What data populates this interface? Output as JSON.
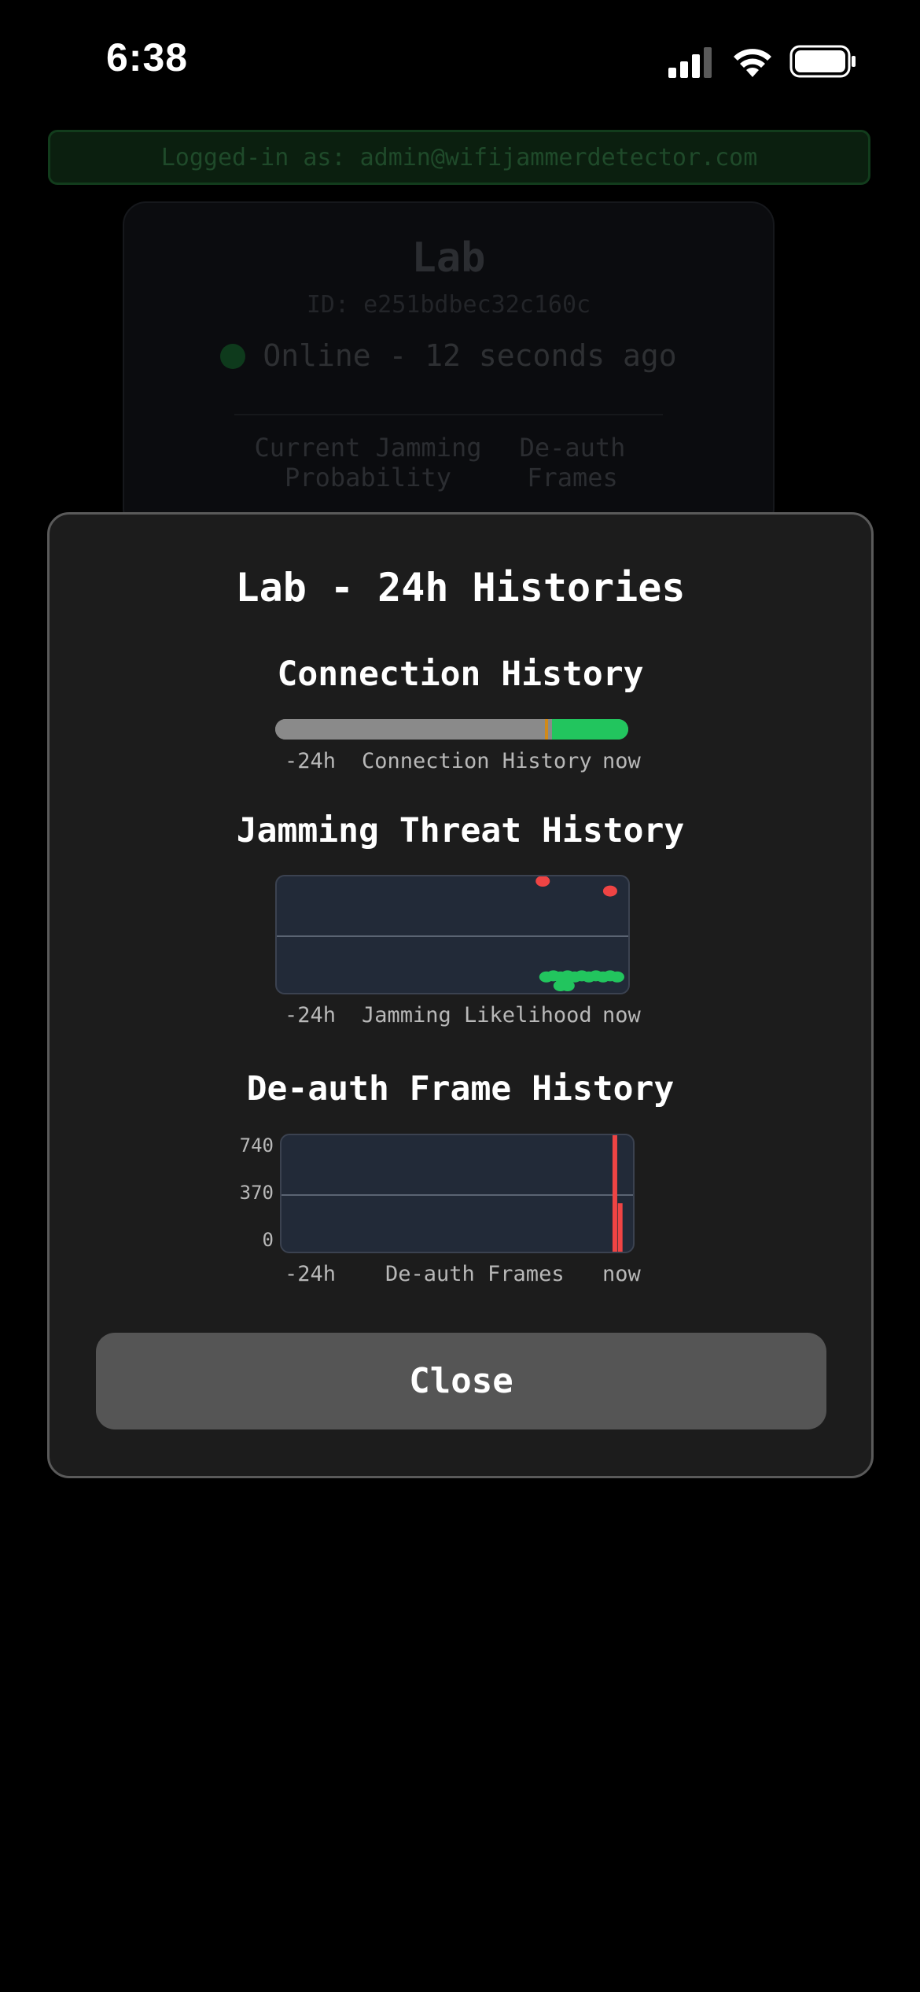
{
  "status_bar": {
    "time": "6:38"
  },
  "background": {
    "login_text": "Logged-in as: admin@wifijammerdetector.com",
    "device": {
      "name": "Lab",
      "id": "ID: e251bdbec32c160c",
      "status": "Online - 12 seconds ago",
      "metric_1": "Current Jamming\nProbability",
      "metric_2": "De-auth\nFrames"
    }
  },
  "modal": {
    "title": "Lab - 24h Histories",
    "close_label": "Close",
    "connection": {
      "title": "Connection History",
      "axis_left": "-24h",
      "axis_center": "Connection History",
      "axis_right": "now",
      "segments": [
        {
          "state": "offline",
          "from": 0.0,
          "to": 0.765,
          "color": "#8a8a8a"
        },
        {
          "state": "transition",
          "from": 0.765,
          "to": 0.773,
          "color": "#d08a1a"
        },
        {
          "state": "gap",
          "from": 0.773,
          "to": 0.785,
          "color": "#8a8a8a"
        },
        {
          "state": "online",
          "from": 0.785,
          "to": 1.0,
          "color": "#22c55e"
        }
      ]
    },
    "jamming": {
      "title": "Jamming Threat History",
      "axis_left": "-24h",
      "axis_center": "Jamming Likelihood",
      "axis_right": "now"
    },
    "deauth": {
      "title": "De-auth Frame History",
      "axis_left": "-24h",
      "axis_center": "De-auth Frames",
      "axis_right": "now",
      "yticks": [
        "740",
        "370",
        "0"
      ]
    }
  },
  "chart_data": [
    {
      "type": "scatter",
      "title": "Jamming Threat History",
      "xlabel": "Jamming Likelihood",
      "x_range": [
        "-24h",
        "now"
      ],
      "ylim": [
        0,
        1
      ],
      "series": [
        {
          "color": "#ef4444",
          "points": [
            [
              0.75,
              1.0
            ],
            [
              0.94,
              0.91
            ]
          ]
        },
        {
          "color": "#22c55e",
          "points": [
            [
              0.76,
              0.13
            ],
            [
              0.78,
              0.14
            ],
            [
              0.8,
              0.13
            ],
            [
              0.82,
              0.14
            ],
            [
              0.84,
              0.13
            ],
            [
              0.86,
              0.14
            ],
            [
              0.88,
              0.13
            ],
            [
              0.9,
              0.14
            ],
            [
              0.92,
              0.13
            ],
            [
              0.94,
              0.14
            ],
            [
              0.96,
              0.13
            ],
            [
              0.8,
              0.05
            ],
            [
              0.82,
              0.05
            ]
          ]
        }
      ]
    },
    {
      "type": "bar",
      "title": "De-auth Frame History",
      "xlabel": "De-auth Frames",
      "x_range": [
        "-24h",
        "now"
      ],
      "ylim": [
        0,
        740
      ],
      "yticks": [
        0,
        370,
        740
      ],
      "bars": [
        {
          "x": 0.83,
          "value": 4,
          "color": "#22c55e"
        },
        {
          "x": 0.94,
          "value": 740,
          "color": "#ef4444"
        },
        {
          "x": 0.955,
          "value": 320,
          "color": "#ef4444"
        },
        {
          "x": 0.97,
          "value": 6,
          "color": "#22c55e"
        }
      ]
    }
  ]
}
